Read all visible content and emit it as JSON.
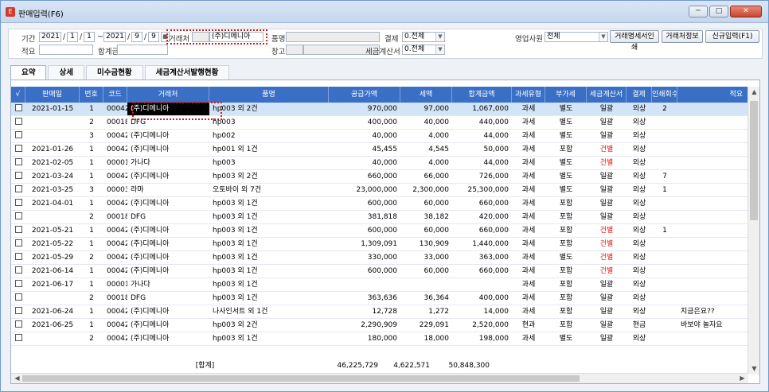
{
  "window": {
    "title": "판매입력(F6)",
    "app_icon": "app-icon",
    "minimize": "─",
    "maximize": "□",
    "close": "✕"
  },
  "form": {
    "period_label": "기간",
    "from_year": "2021",
    "from_month": "1",
    "from_day": "1",
    "range_sep": "~",
    "to_year": "2021",
    "to_month": "9",
    "to_day": "9",
    "calendar_icon": "calendar-icon",
    "client_label": "거래처",
    "client_value": "(주)디메니아",
    "item_label": "품명",
    "item_value": "",
    "warehouse_label": "창고",
    "payment_label": "결제",
    "payment_value": "0.전체",
    "tax_invoice_label": "세금계산서",
    "tax_invoice_value": "0.전체",
    "memo_label": "적요",
    "total_amount_label": "합계금액",
    "sales_rep_label": "영업사원",
    "sales_rep_value": "전체",
    "btn_statement_print": "거래명세서인쇄",
    "btn_client_info": "거래처정보",
    "btn_new_entry": "신규입력(F1)"
  },
  "tabs": [
    "요약",
    "상세",
    "미수금현황",
    "세금계산서발행현황"
  ],
  "table": {
    "columns": [
      "√",
      "판매일",
      "번호",
      "코드",
      "거래처",
      "품명",
      "공급가액",
      "세액",
      "합계금액",
      "과세유형",
      "부가세",
      "세금계산서",
      "결제",
      "인쇄회수",
      "적요"
    ],
    "rows": [
      [
        "",
        "2021-01-15",
        "1",
        "00042",
        "(주)디메니아",
        "hp003 외 2건",
        "970,000",
        "97,000",
        "1,067,000",
        "과세",
        "별도",
        "일괄",
        "외상",
        "2",
        ""
      ],
      [
        "",
        "",
        "2",
        "00018",
        "DFG",
        "hp003",
        "400,000",
        "40,000",
        "440,000",
        "과세",
        "별도",
        "일괄",
        "외상",
        "",
        ""
      ],
      [
        "",
        "",
        "3",
        "00042",
        "(주)디메니아",
        "hp002",
        "40,000",
        "4,000",
        "44,000",
        "과세",
        "별도",
        "일괄",
        "외상",
        "",
        ""
      ],
      [
        "",
        "2021-01-26",
        "1",
        "00042",
        "(주)디메니아",
        "hp001 외 1건",
        "45,455",
        "4,545",
        "50,000",
        "과세",
        "포함",
        "건별",
        "외상",
        "",
        ""
      ],
      [
        "",
        "2021-02-05",
        "1",
        "00001",
        "가나다",
        "hp003",
        "40,000",
        "4,000",
        "44,000",
        "과세",
        "별도",
        "건별",
        "외상",
        "",
        ""
      ],
      [
        "",
        "2021-03-24",
        "1",
        "00042",
        "(주)디메니아",
        "hp003 외 2건",
        "660,000",
        "66,000",
        "726,000",
        "과세",
        "별도",
        "일괄",
        "외상",
        "7",
        ""
      ],
      [
        "",
        "2021-03-25",
        "3",
        "00003",
        "라마",
        "오토바이 외 7건",
        "23,000,000",
        "2,300,000",
        "25,300,000",
        "과세",
        "별도",
        "일괄",
        "외상",
        "1",
        ""
      ],
      [
        "",
        "2021-04-01",
        "1",
        "00042",
        "(주)디메니아",
        "hp003 외 1건",
        "600,000",
        "60,000",
        "660,000",
        "과세",
        "포함",
        "일괄",
        "외상",
        "",
        ""
      ],
      [
        "",
        "",
        "2",
        "00018",
        "DFG",
        "hp003 외 1건",
        "381,818",
        "38,182",
        "420,000",
        "과세",
        "포함",
        "일괄",
        "외상",
        "",
        ""
      ],
      [
        "",
        "2021-05-21",
        "1",
        "00042",
        "(주)디메니아",
        "hp003 외 1건",
        "600,000",
        "60,000",
        "660,000",
        "과세",
        "포함",
        "건별",
        "외상",
        "1",
        ""
      ],
      [
        "",
        "2021-05-22",
        "1",
        "00042",
        "(주)디메니아",
        "hp003 외 1건",
        "1,309,091",
        "130,909",
        "1,440,000",
        "과세",
        "포함",
        "건별",
        "외상",
        "",
        ""
      ],
      [
        "",
        "2021-05-29",
        "2",
        "00042",
        "(주)디메니아",
        "hp003 외 1건",
        "330,000",
        "33,000",
        "363,000",
        "과세",
        "별도",
        "건별",
        "외상",
        "",
        ""
      ],
      [
        "",
        "2021-06-14",
        "1",
        "00042",
        "(주)디메니아",
        "hp003 외 1건",
        "600,000",
        "60,000",
        "660,000",
        "과세",
        "포함",
        "건별",
        "외상",
        "",
        ""
      ],
      [
        "",
        "2021-06-17",
        "1",
        "00001",
        "가나다",
        "hp003 외 1건",
        "",
        "",
        "",
        "과세",
        "포함",
        "일괄",
        "외상",
        "",
        ""
      ],
      [
        "",
        "",
        "2",
        "00018",
        "DFG",
        "hp003 외 1건",
        "363,636",
        "36,364",
        "400,000",
        "과세",
        "포함",
        "일괄",
        "외상",
        "",
        ""
      ],
      [
        "",
        "2021-06-24",
        "1",
        "00042",
        "(주)디메니아",
        "나사인서트 외 1건",
        "12,728",
        "1,272",
        "14,000",
        "과세",
        "포함",
        "일괄",
        "외상",
        "",
        "지금은요??"
      ],
      [
        "",
        "2021-06-25",
        "1",
        "00042",
        "(주)디메니아",
        "hp003 외 2건",
        "2,290,909",
        "229,091",
        "2,520,000",
        "현과",
        "포함",
        "일괄",
        "현금",
        "",
        "바보야 놀자요"
      ],
      [
        "",
        "",
        "2",
        "00042",
        "(주)디메니아",
        "hp003 외 1건",
        "180,000",
        "18,000",
        "198,000",
        "과세",
        "별도",
        "일괄",
        "외상",
        "",
        ""
      ]
    ],
    "red_tax_invoice_value": "건별",
    "totals": {
      "label": "[합계]",
      "supply": "46,225,729",
      "tax": "4,622,571",
      "total": "50,848,300"
    }
  },
  "colors": {
    "header_bg": "#3a6fc6",
    "highlight": "#d21c1c",
    "selected_row": "#d3e4f7"
  }
}
